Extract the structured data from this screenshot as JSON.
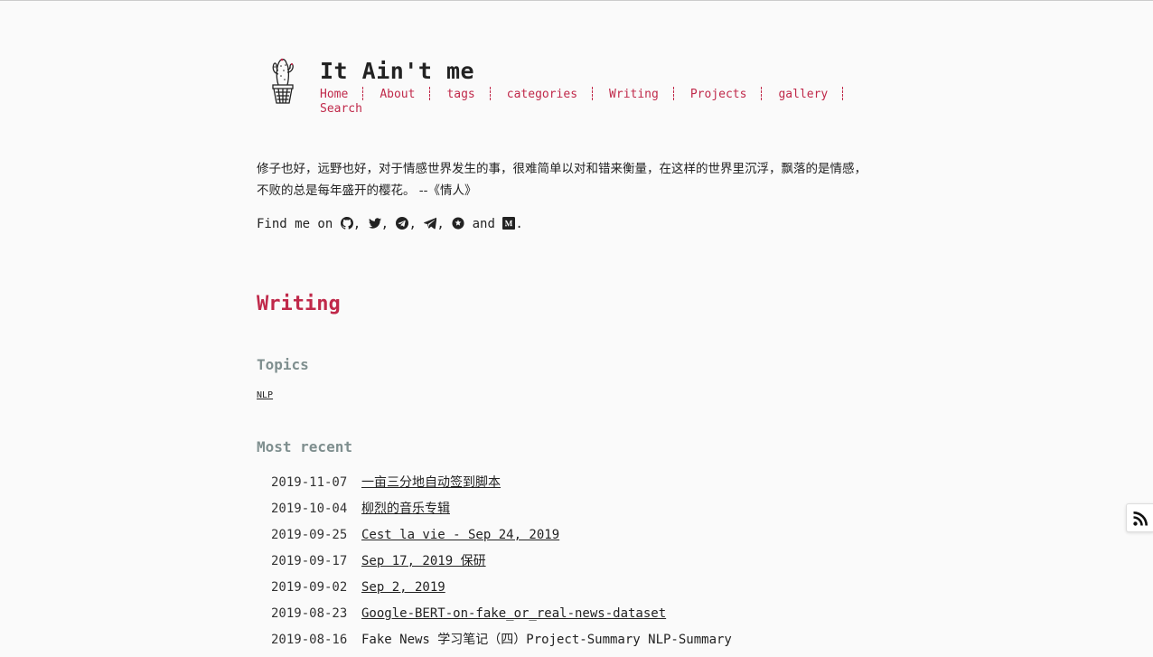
{
  "site": {
    "title": "It Ain't me",
    "logo_icon": "cactus-logo-icon"
  },
  "nav": {
    "items": [
      {
        "label": "Home"
      },
      {
        "label": "About"
      },
      {
        "label": "tags"
      },
      {
        "label": "categories"
      },
      {
        "label": "Writing"
      },
      {
        "label": "Projects"
      },
      {
        "label": "gallery"
      },
      {
        "label": "Search"
      }
    ],
    "color": "#c0294a"
  },
  "intro": {
    "quote_line1": "修子也好，远野也好，对于情感世界发生的事，很难简单以对和错来衡量，在这样的世界里沉浮，飘落的是情感，",
    "quote_line2": "不败的总是每年盛开的樱花。 --《情人》",
    "findme_prefix": "Find me on",
    "findme_and": "and",
    "findme_end": ".",
    "social_icons": [
      "github-icon",
      "twitter-icon",
      "telegram-icon",
      "telegram-plane-icon",
      "mastodon-icon",
      "medium-icon"
    ]
  },
  "writing": {
    "heading": "Writing",
    "topics_heading": "Topics",
    "topics": [
      "NLP"
    ],
    "recent_heading": "Most recent",
    "posts": [
      {
        "date": "2019-11-07",
        "title": "一亩三分地自动签到脚本"
      },
      {
        "date": "2019-10-04",
        "title": "柳烈的音乐专辑"
      },
      {
        "date": "2019-09-25",
        "title": "Cest la vie - Sep 24, 2019"
      },
      {
        "date": "2019-09-17",
        "title": "Sep 17, 2019 保研"
      },
      {
        "date": "2019-09-02",
        "title": "Sep 2, 2019"
      },
      {
        "date": "2019-08-23",
        "title": "Google-BERT-on-fake_or_real-news-dataset"
      },
      {
        "date": "2019-08-16",
        "title": "Fake News 学习笔记（四）Project-Summary NLP-Summary"
      }
    ]
  },
  "rss": {
    "icon": "rss-icon"
  }
}
